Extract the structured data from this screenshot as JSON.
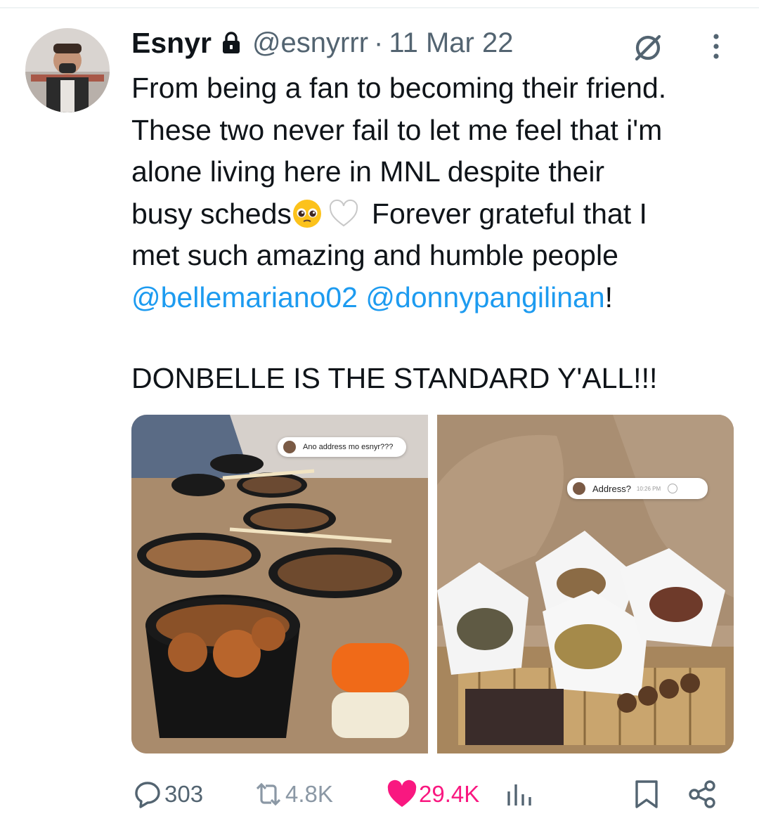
{
  "tweet": {
    "author_name": "Esnyr",
    "handle": "@esnyrrr",
    "separator": "·",
    "date": "11 Mar 22",
    "lines": [
      "From being a fan to becoming their friend.",
      "These two never fail to let me feel that i'm",
      "alone living here in MNL despite their"
    ],
    "line4_pre": "busy scheds",
    "line4_post": "Forever grateful that I",
    "line5": "met such amazing and humble people",
    "mention1": "@bellemariano02",
    "mention2": "@donnypangilinan",
    "mention_suffix": "!",
    "shout": "DONBELLE IS THE STANDARD Y'ALL!!!"
  },
  "media": {
    "left_chat": "Ano address mo esnyr???",
    "right_chat": "Address?",
    "right_chat_time": "10:26 PM"
  },
  "actions": {
    "replies": "303",
    "reposts": "4.8K",
    "likes": "29.4K"
  },
  "colors": {
    "text": "#0f1419",
    "secondary": "#536471",
    "link": "#1d9bf0",
    "like": "#f91880"
  },
  "icons": [
    "lock-icon",
    "grok-icon",
    "more-icon",
    "pleading-face-emoji",
    "white-heart-emoji",
    "reply-icon",
    "repost-icon",
    "like-icon",
    "views-icon",
    "bookmark-icon",
    "share-icon"
  ]
}
